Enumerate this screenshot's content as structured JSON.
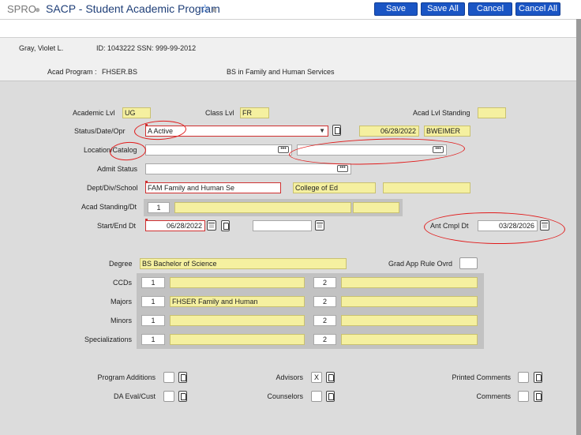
{
  "header": {
    "app_code": "SPRO",
    "title": "SACP - Student Academic Program",
    "buttons": {
      "save": "Save",
      "save_all": "Save All",
      "cancel": "Cancel",
      "cancel_all": "Cancel All"
    }
  },
  "student": {
    "name": "Gray,  Violet L.",
    "ids": "ID: 1043222 SSN: 999-99-2012",
    "acad_program_label": "Acad Program :",
    "acad_program_code": "FHSER.BS",
    "acad_program_desc": "BS in Family and Human Services"
  },
  "form": {
    "academic_lvl": {
      "label": "Academic Lvl",
      "value": "UG"
    },
    "class_lvl": {
      "label": "Class Lvl",
      "value": "FR"
    },
    "acad_lvl_standing": {
      "label": "Acad Lvl Standing",
      "value": ""
    },
    "status_date_opr": {
      "label": "Status/Date/Opr",
      "status": "A Active",
      "date": "06/28/2022",
      "opr": "BWEIMER"
    },
    "location_catalog": {
      "label": "Location/Catalog",
      "location": "",
      "catalog": ""
    },
    "admit_status": {
      "label": "Admit Status",
      "value": ""
    },
    "dept_div_school": {
      "label": "Dept/Div/School",
      "dept": "FAM Family and Human Se",
      "div": "College of Ed",
      "school": ""
    },
    "acad_standing_dt": {
      "label": "Acad Standing/Dt",
      "num": "1",
      "standing": "",
      "dt": ""
    },
    "start_end_dt": {
      "label": "Start/End Dt",
      "start": "06/28/2022",
      "end": ""
    },
    "ant_cmpl_dt": {
      "label": "Ant Cmpl Dt",
      "value": "03/28/2026"
    },
    "degree": {
      "label": "Degree",
      "value": "BS Bachelor of Science"
    },
    "grad_app_rule_ovrd": {
      "label": "Grad App Rule Ovrd",
      "value": ""
    },
    "ccds": {
      "label": "CCDs",
      "n1": "1",
      "v1": "",
      "n2": "2",
      "v2": ""
    },
    "majors": {
      "label": "Majors",
      "n1": "1",
      "v1": "FHSER Family and Human",
      "n2": "2",
      "v2": ""
    },
    "minors": {
      "label": "Minors",
      "n1": "1",
      "v1": "",
      "n2": "2",
      "v2": ""
    },
    "specializations": {
      "label": "Specializations",
      "n1": "1",
      "v1": "",
      "n2": "2",
      "v2": ""
    }
  },
  "bottom": {
    "program_additions": {
      "label": "Program Additions",
      "value": ""
    },
    "da_eval_cust": {
      "label": "DA Eval/Cust",
      "value": ""
    },
    "advisors": {
      "label": "Advisors",
      "value": "X"
    },
    "counselors": {
      "label": "Counselors",
      "value": ""
    },
    "printed_comments": {
      "label": "Printed Comments",
      "value": ""
    },
    "comments": {
      "label": "Comments",
      "value": ""
    }
  },
  "colors": {
    "accent": "#1a55c4",
    "readonly": "#f5f0a0",
    "annotation": "#e11b1b"
  }
}
